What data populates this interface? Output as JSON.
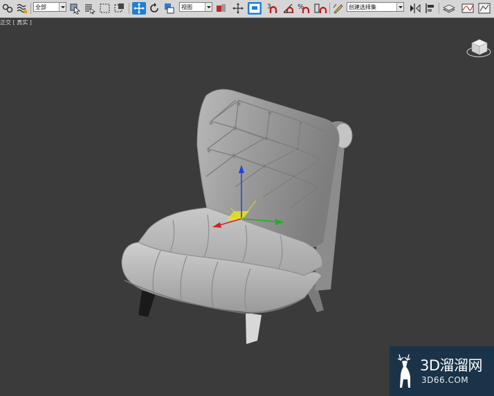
{
  "toolbar": {
    "selection_filter": "全部",
    "ref_coord_system": "视图",
    "named_selection_set": "创建选择集",
    "snap_label": "3",
    "percent_snap_label": "%"
  },
  "viewport": {
    "label": "正交 [ 真实 ]"
  },
  "watermark": {
    "brand": "3D溜溜网",
    "domain": "3D66.COM"
  },
  "colors": {
    "toolbar_bg": "#d6d6d6",
    "viewport_bg": "#3b3b3b",
    "active_tool": "#1f7fd6",
    "gizmo_x": "#d02020",
    "gizmo_y": "#20b020",
    "gizmo_z": "#2040e0",
    "gizmo_plane": "#e8e020",
    "watermark_bg": "#1b3348"
  },
  "icons": [
    "select-link-icon",
    "unlink-icon",
    "bind-spacewarp-icon",
    "select-object-icon",
    "select-by-name-icon",
    "rectangular-selection-icon",
    "window-crossing-icon",
    "select-move-icon",
    "select-rotate-icon",
    "select-scale-icon",
    "pivot-center-icon",
    "select-manipulate-icon",
    "keyboard-shortcut-icon",
    "snaps-toggle-icon",
    "angle-snap-icon",
    "percent-snap-icon",
    "spinner-snap-icon",
    "edit-named-selection-icon",
    "mirror-icon",
    "align-icon",
    "layer-explorer-icon",
    "curve-editor-icon",
    "schematic-view-icon",
    "viewcube-icon",
    "deer-logo-icon"
  ]
}
